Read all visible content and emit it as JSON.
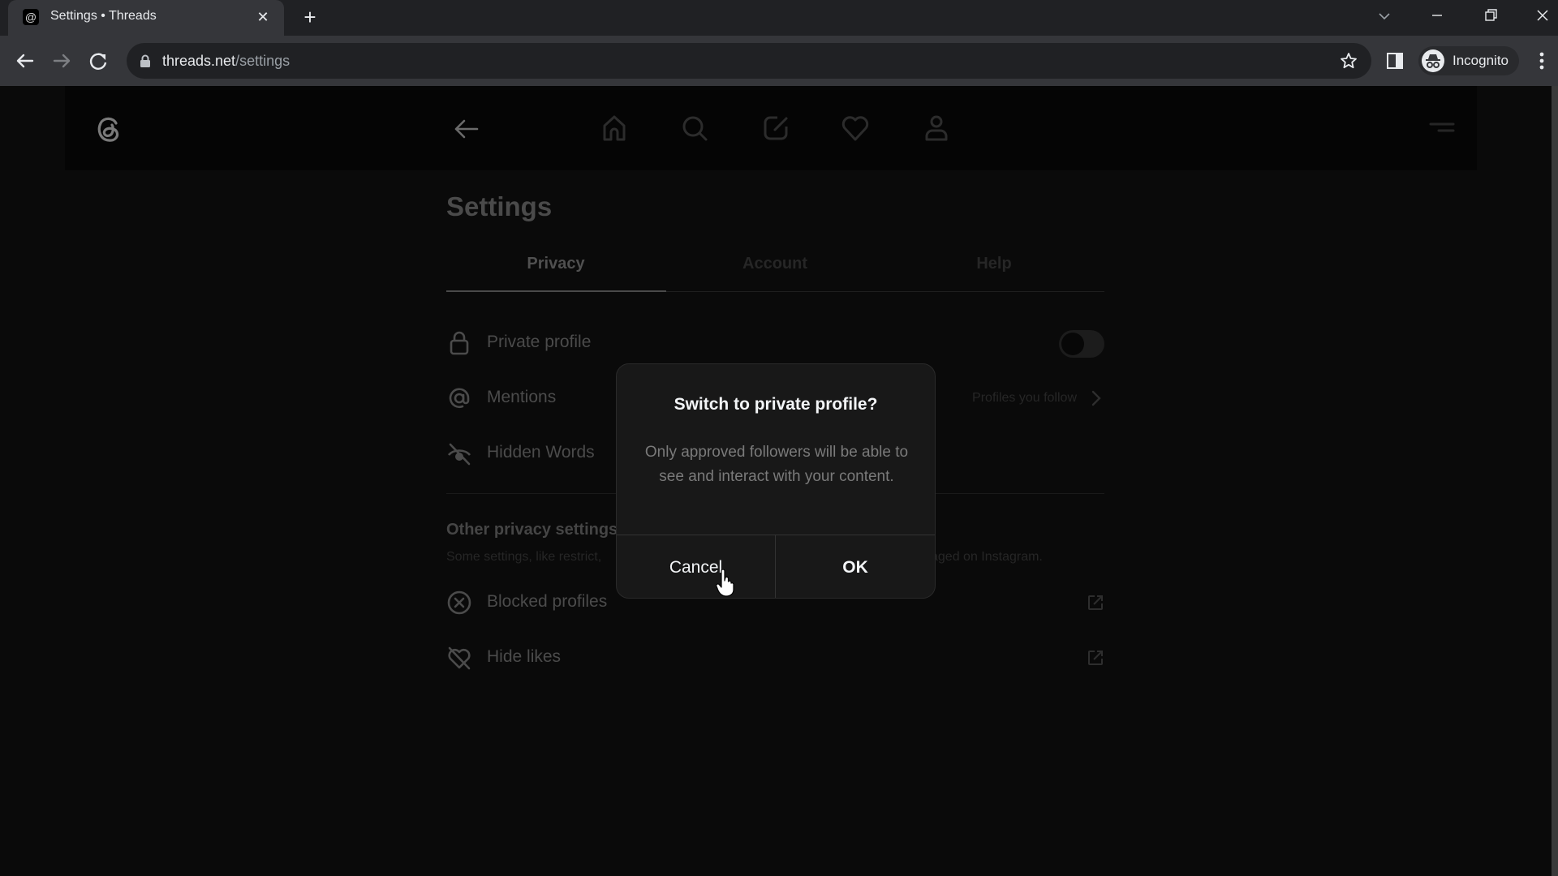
{
  "browser": {
    "tab": {
      "title": "Settings • Threads",
      "favicon": "threads-icon"
    },
    "new_tab_label": "+",
    "url": {
      "host": "threads.net",
      "path": "/settings"
    },
    "profile_label": "Incognito",
    "controls": [
      "back-icon",
      "forward-icon",
      "reload-icon",
      "lock-icon",
      "star-icon",
      "side-panel-icon",
      "incognito-icon",
      "kebab-menu-icon",
      "tab-search-icon",
      "minimize-icon",
      "restore-icon",
      "close-icon"
    ]
  },
  "header": {
    "logo": "threads-logo-icon",
    "back": "back-arrow-icon",
    "nav": [
      "home-icon",
      "search-icon",
      "compose-icon",
      "heart-icon",
      "profile-icon"
    ],
    "menu": "menu-icon"
  },
  "settings": {
    "title": "Settings",
    "tabs": [
      {
        "label": "Privacy",
        "active": true
      },
      {
        "label": "Account",
        "active": false
      },
      {
        "label": "Help",
        "active": false
      }
    ],
    "rows": [
      {
        "label": "Private profile",
        "icon": "lock-icon",
        "toggle_on": false
      },
      {
        "label": "Mentions",
        "icon": "at-icon",
        "value": "Profiles you follow"
      },
      {
        "label": "Hidden Words",
        "icon": "eye-off-icon"
      }
    ],
    "other": {
      "title": "Other privacy settings",
      "subtitle_left": "Some settings, like restrict,",
      "subtitle_right": "aged on Instagram.",
      "rows": [
        {
          "label": "Blocked profiles",
          "icon": "blocked-icon"
        },
        {
          "label": "Hide likes",
          "icon": "heart-off-icon"
        }
      ]
    }
  },
  "dialog": {
    "title": "Switch to private profile?",
    "body": "Only approved followers will be able to see and interact with your content.",
    "cancel_label": "Cancel",
    "ok_label": "OK"
  },
  "colors": {
    "page_bg": "#0a0a0a",
    "dialog_bg": "#181818",
    "dialog_text": "#f3f5f7",
    "chrome_toolbar": "#35363a",
    "chrome_tabbar": "#202124"
  }
}
